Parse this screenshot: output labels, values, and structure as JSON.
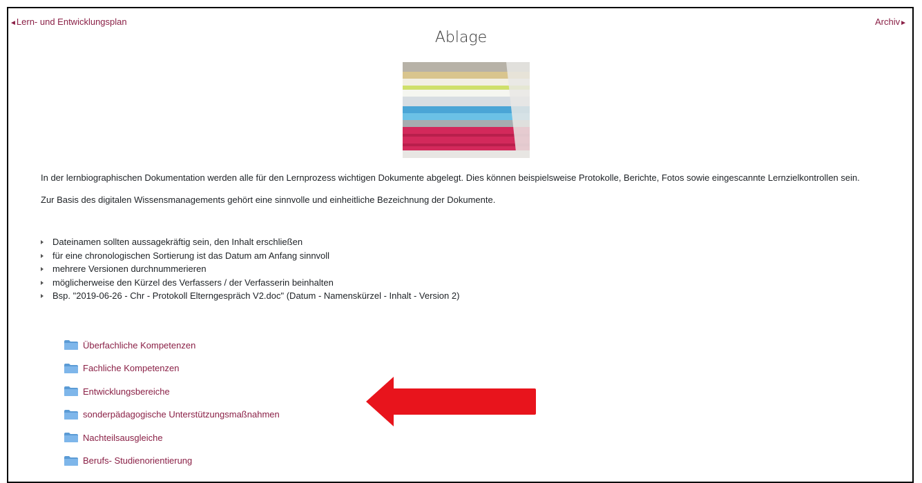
{
  "nav": {
    "prev_label": "Lern- und Entwicklungsplan",
    "next_label": "Archiv"
  },
  "page": {
    "title": "Ablage"
  },
  "content": {
    "paragraph1": "In der lernbiographischen Dokumentation werden alle für den Lernprozess wichtigen Dokumente abgelegt. Dies können beispielsweise Protokolle, Berichte, Fotos sowie eingescannte Lernzielkontrollen sein.",
    "paragraph2": "Zur Basis des digitalen Wissensmanagements gehört eine sinnvolle und einheitliche Bezeichnung der Dokumente.",
    "bullets": [
      "Dateinamen sollten aussagekräftig sein, den Inhalt erschließen",
      "für eine chronologischen Sortierung ist das Datum am Anfang sinnvoll",
      "mehrere Versionen durchnummerieren",
      "möglicherweise den Kürzel des Verfassers / der Verfasserin beinhalten",
      "Bsp. \"2019-06-26 - Chr - Protokoll Elterngespräch V2.doc\" (Datum - Namenskürzel - Inhalt - Version 2)"
    ]
  },
  "folders": [
    {
      "label": "Überfachliche Kompetenzen",
      "icon": "folder-icon"
    },
    {
      "label": "Fachliche Kompetenzen",
      "icon": "folder-icon"
    },
    {
      "label": "Entwicklungsbereiche",
      "icon": "folder-icon"
    },
    {
      "label": "sonderpädagogische Unterstützungsmaßnahmen",
      "icon": "folder-icon"
    },
    {
      "label": "Nachteilsausgleiche",
      "icon": "folder-icon"
    },
    {
      "label": "Berufs- Studienorientierung",
      "icon": "folder-icon"
    }
  ],
  "colors": {
    "link": "#8a2046",
    "folder": "#5b9bd5",
    "annotation_arrow": "#e8141c"
  },
  "annotation": {
    "icon": "red-arrow-left-icon"
  }
}
